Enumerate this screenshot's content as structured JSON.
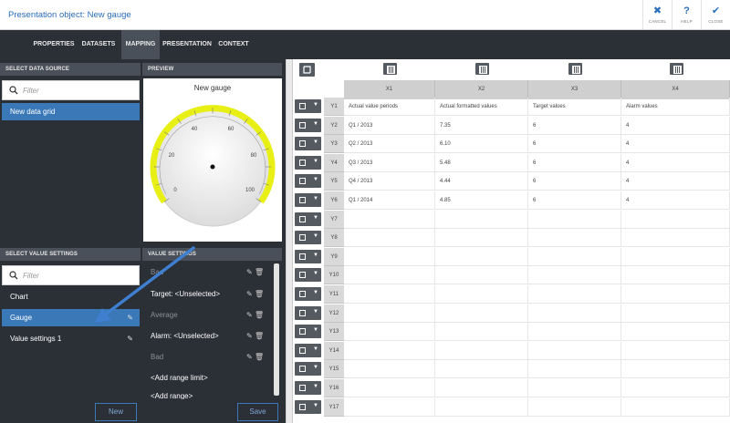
{
  "window": {
    "title": "Presentation object: New gauge",
    "actions": [
      {
        "label": "CANCEL",
        "icon": "✖"
      },
      {
        "label": "HELP",
        "icon": "?"
      },
      {
        "label": "CLOSE",
        "icon": "✔"
      }
    ]
  },
  "tabs": [
    "PROPERTIES",
    "DATASETS",
    "MAPPING",
    "PRESENTATION",
    "CONTEXT"
  ],
  "active_tab": "MAPPING",
  "data_source": {
    "header": "SELECT DATA SOURCE",
    "filter_placeholder": "Filter",
    "items": [
      "New data grid"
    ]
  },
  "preview": {
    "header": "PREVIEW",
    "gauge_title": "New gauge",
    "ticks": [
      "0",
      "20",
      "40",
      "60",
      "80",
      "100"
    ]
  },
  "value_settings_list": {
    "header": "SELECT VALUE SETTINGS",
    "filter_placeholder": "Filter",
    "items": [
      "Chart",
      "Gauge",
      "Value settings 1"
    ],
    "selected": "Gauge",
    "new_label": "New"
  },
  "value_settings": {
    "header": "VALUE SETTINGS",
    "rows": [
      {
        "label": "Bad",
        "dim": true,
        "icons": true
      },
      {
        "label": "Target: <Unselected>",
        "dim": false,
        "icons": true
      },
      {
        "label": "Average",
        "dim": true,
        "icons": true
      },
      {
        "label": "Alarm: <Unselected>",
        "dim": false,
        "icons": true
      },
      {
        "label": "Bad",
        "dim": true,
        "icons": true
      },
      {
        "label": "<Add range limit>",
        "dim": false,
        "icons": false
      },
      {
        "label": "<Add range>",
        "dim": false,
        "icons": false
      }
    ],
    "save_label": "Save"
  },
  "grid": {
    "columns": [
      "X1",
      "X2",
      "X3",
      "X4"
    ],
    "rows": [
      {
        "y": "Y1",
        "cells": [
          "Actual value periods",
          "Actual formatted values",
          "Target values",
          "Alarm values"
        ]
      },
      {
        "y": "Y2",
        "cells": [
          "Q1 / 2013",
          "7.35",
          "6",
          "4"
        ]
      },
      {
        "y": "Y3",
        "cells": [
          "Q2 / 2013",
          "6.10",
          "6",
          "4"
        ]
      },
      {
        "y": "Y4",
        "cells": [
          "Q3 / 2013",
          "5.48",
          "6",
          "4"
        ]
      },
      {
        "y": "Y5",
        "cells": [
          "Q4 / 2013",
          "4.44",
          "6",
          "4"
        ]
      },
      {
        "y": "Y6",
        "cells": [
          "Q1 / 2014",
          "4.85",
          "6",
          "4"
        ]
      },
      {
        "y": "Y7",
        "cells": [
          "",
          "",
          "",
          ""
        ]
      },
      {
        "y": "Y8",
        "cells": [
          "",
          "",
          "",
          ""
        ]
      },
      {
        "y": "Y9",
        "cells": [
          "",
          "",
          "",
          ""
        ]
      },
      {
        "y": "Y10",
        "cells": [
          "",
          "",
          "",
          ""
        ]
      },
      {
        "y": "Y11",
        "cells": [
          "",
          "",
          "",
          ""
        ]
      },
      {
        "y": "Y12",
        "cells": [
          "",
          "",
          "",
          ""
        ]
      },
      {
        "y": "Y13",
        "cells": [
          "",
          "",
          "",
          ""
        ]
      },
      {
        "y": "Y14",
        "cells": [
          "",
          "",
          "",
          ""
        ]
      },
      {
        "y": "Y15",
        "cells": [
          "",
          "",
          "",
          ""
        ]
      },
      {
        "y": "Y16",
        "cells": [
          "",
          "",
          "",
          ""
        ]
      },
      {
        "y": "Y17",
        "cells": [
          "",
          "",
          "",
          ""
        ]
      }
    ]
  }
}
